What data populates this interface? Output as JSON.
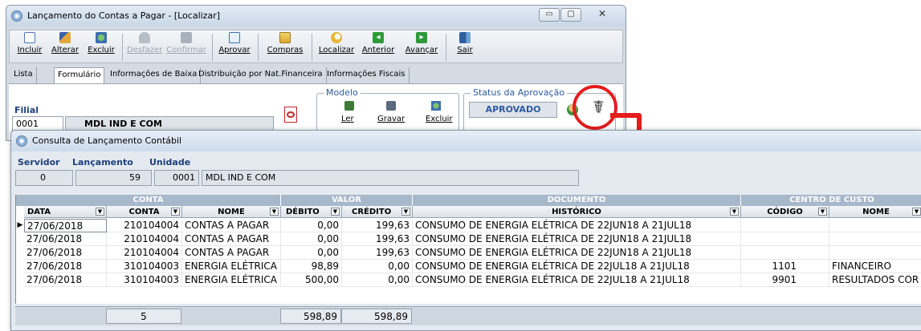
{
  "back_window": {
    "title": "Lançamento do Contas a Pagar - [Localizar]",
    "toolbar": [
      {
        "label": "Incluir",
        "icon": "new-document-icon",
        "enabled": true
      },
      {
        "label": "Alterar",
        "icon": "pencil-icon",
        "enabled": true
      },
      {
        "label": "Excluir",
        "icon": "delete-icon",
        "enabled": true
      },
      {
        "label": "Desfazer",
        "icon": "undo-icon",
        "enabled": false
      },
      {
        "label": "Confirmar",
        "icon": "confirm-icon",
        "enabled": false
      },
      {
        "label": "Aprovar",
        "icon": "approve-icon",
        "enabled": true
      },
      {
        "label": "Compras",
        "icon": "purchases-icon",
        "enabled": true
      },
      {
        "label": "Localizar",
        "icon": "search-icon",
        "enabled": true
      },
      {
        "label": "Anterior",
        "icon": "previous-icon",
        "enabled": true
      },
      {
        "label": "Avançar",
        "icon": "next-icon",
        "enabled": true
      },
      {
        "label": "Sair",
        "icon": "exit-door-icon",
        "enabled": true
      }
    ],
    "tabs": [
      "Lista",
      "Formulário",
      "Informações de Baixa",
      "Distribuição por Nat.Financeira",
      "Informações Fiscais"
    ],
    "active_tab": "Formulário",
    "filial": {
      "label": "Filial",
      "code": "0001",
      "name": "MDL IND E COM"
    },
    "modelo": {
      "legend": "Modelo",
      "buttons": [
        "Ler",
        "Gravar",
        "Excluir"
      ]
    },
    "status": {
      "legend": "Status da Aprovação",
      "value": "APROVADO"
    }
  },
  "front_window": {
    "title": "Consulta de Lançamento Contábil",
    "header": {
      "servidor_label": "Servidor",
      "servidor": "0",
      "lancamento_label": "Lançamento",
      "lancamento": "59",
      "unidade_label": "Unidade",
      "unidade_code": "0001",
      "unidade_name": "MDL IND E COM"
    },
    "grid": {
      "groups": [
        "CONTA",
        "VALOR",
        "DOCUMENTO",
        "CENTRO DE CUSTO"
      ],
      "columns": [
        "DATA",
        "CONTA",
        "NOME",
        "DÉBITO",
        "CRÉDITO",
        "HISTÓRICO",
        "CÓDIGO",
        "NOME"
      ],
      "rows": [
        [
          "27/06/2018",
          "210104004",
          "CONTAS A PAGAR",
          "0,00",
          "199,63",
          "CONSUMO DE ENERGIA ELÉTRICA DE 22JUN18 A 21JUL18",
          "",
          ""
        ],
        [
          "27/06/2018",
          "210104004",
          "CONTAS A PAGAR",
          "0,00",
          "199,63",
          "CONSUMO DE ENERGIA ELÉTRICA DE 22JUN18 A 21JUL18",
          "",
          ""
        ],
        [
          "27/06/2018",
          "210104004",
          "CONTAS A PAGAR",
          "0,00",
          "199,63",
          "CONSUMO DE ENERGIA ELÉTRICA DE 22JUN18 A 21JUL18",
          "",
          ""
        ],
        [
          "27/06/2018",
          "310104003",
          "ENERGIA ELÉTRICA",
          "98,89",
          "0,00",
          "CONSUMO DE ENERGIA ELÉTRICA DE 22JUL18 A 21JUL18",
          "1101",
          "FINANCEIRO"
        ],
        [
          "27/06/2018",
          "310104003",
          "ENERGIA ELÉTRICA",
          "500,00",
          "0,00",
          "CONSUMO DE ENERGIA ELÉTRICA DE 22JUL18 A 21JUL18",
          "9901",
          "RESULTADOS COR"
        ]
      ],
      "totals": {
        "count": "5",
        "debito": "598,89",
        "credito": "598,89"
      }
    }
  },
  "colors": {
    "highlight": "#e41c1c",
    "label_blue": "#1d3f7a",
    "group_header": "#a8b8cb",
    "status_blue": "#2d5aa0"
  }
}
